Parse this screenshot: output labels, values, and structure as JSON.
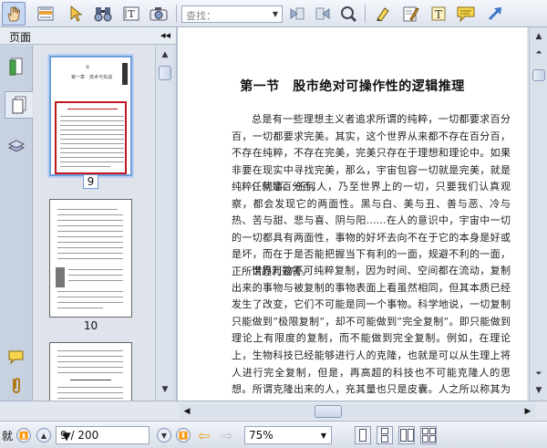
{
  "toolbar": {
    "search_placeholder": "查找：",
    "tools": [
      "hand-tool",
      "select-text-tool",
      "select-tool",
      "binoculars",
      "typewriter",
      "snapshot",
      "previous-result",
      "next-result",
      "find"
    ],
    "annotation_tools": [
      "highlight",
      "note-edit",
      "text-box",
      "comment",
      "arrow"
    ]
  },
  "sidebar": {
    "title": "页面",
    "tabs": [
      "pages",
      "bookmarks",
      "layers",
      "comments",
      "attachments"
    ]
  },
  "thumbnails": [
    {
      "label": "9",
      "selected": true
    },
    {
      "label": "10",
      "selected": false
    }
  ],
  "document": {
    "heading": "第一节　股市绝对可操作性的逻辑推理",
    "paragraphs": [
      "总是有一些理想主义者追求所谓的纯粹，一切都要求百分百，一切都要求完美。其实，这个世界从来都不存在百分百，不存在纯粹，不存在完美，完美只存在于理想和理论中。如果非要在现实中寻找完美，那么，宇宙包容一切就是完美，就是纯粹，就是百分百。",
      "任何事、任何人，乃至世界上的一切，只要我们认真观察，都会发现它的两面性。黑与白、美与丑、善与恶、冷与热、苦与甜、悲与喜、阴与阳……在人的意识中，宇宙中一切的一切都具有两面性，事物的好坏去向不在于它的本身是好或是坏，而在于是否能把握当下有利的一面，规避不利的一面，正所谓趋利避害。",
      "世界万物不可纯粹复制，因为时间、空间都在流动，复制出来的事物与被复制的事物表面上看虽然相同，但其本质已经发生了改变，它们不可能是同一个事物。科学地说，一切复制只能做到“极限复制”，却不可能做到“完全复制”。即只能做到理论上有限度的复制，而不能做到完全复制。例如，在理论上，生物科技已经能够进行人的克隆，也就是可以从生理上将人进行完全复制，但是，再高超的科技也不可能克隆人的思想。所谓克隆出来的人，充其量也只是皮囊。人之所以称其为人，是因为包括肉身和思想，因此，所谓纯粹的“克隆”是不存在"
    ]
  },
  "navigation": {
    "status": "就",
    "page_display": "9 / 200",
    "zoom": "75%"
  },
  "colors": {
    "selection": "#6f9edb",
    "toolbar_bg": "#e6ebf3",
    "accent_red": "#c0181e"
  }
}
